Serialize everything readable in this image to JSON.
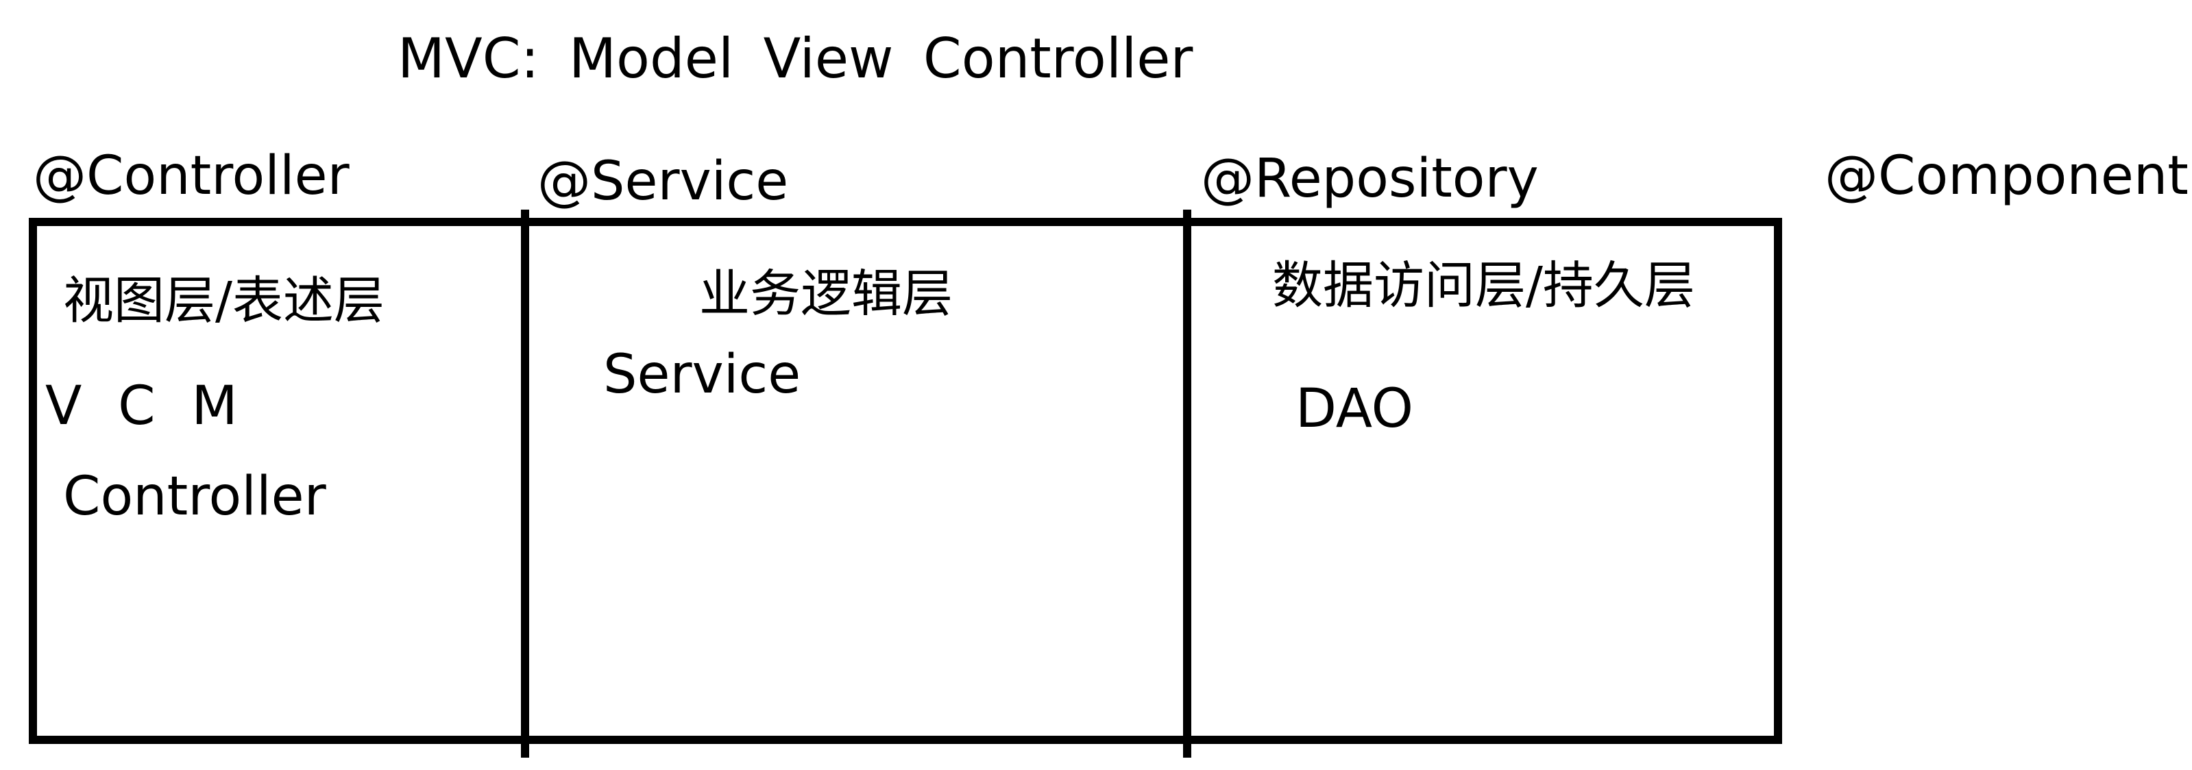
{
  "title": "MVC:  Model  View  Controller",
  "annotations": {
    "controller": "@Controller",
    "service": "@Service",
    "repository": "@Repository",
    "component": "@Component"
  },
  "layers": {
    "view": {
      "name": "视图层/表述层",
      "letters": "V C M",
      "item": "Controller"
    },
    "business": {
      "name": "业务逻辑层",
      "item": "Service"
    },
    "data": {
      "name": "数据访问层/持久层",
      "item": "DAO"
    }
  }
}
